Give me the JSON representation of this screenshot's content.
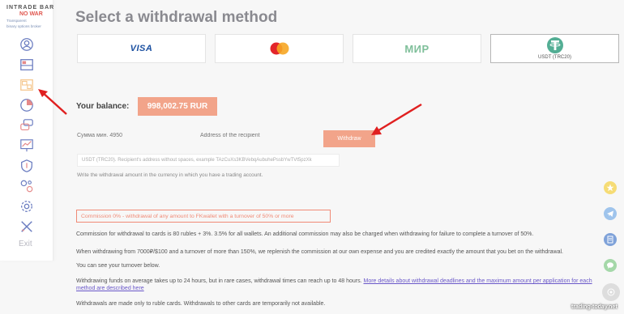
{
  "brand": {
    "name": "INTRADE BAR",
    "nowar": "NO WAR",
    "tagline_1": "Transparent",
    "tagline_2": "binary options broker"
  },
  "sidebar": {
    "items": [
      {
        "icon": "user-icon"
      },
      {
        "icon": "dashboard-icon"
      },
      {
        "icon": "finance-icon",
        "active": true
      },
      {
        "icon": "history-icon"
      },
      {
        "icon": "chat-icon"
      },
      {
        "icon": "analytics-icon"
      },
      {
        "icon": "security-icon"
      },
      {
        "icon": "settings-tools-icon"
      },
      {
        "icon": "gear-icon"
      },
      {
        "icon": "trade-swords-icon"
      }
    ],
    "exit_label": "Exit"
  },
  "page": {
    "title": "Select a withdrawal method"
  },
  "methods": [
    {
      "label": "VISA"
    },
    {
      "label": "MasterCard"
    },
    {
      "label": "МИР"
    },
    {
      "label": "USDT (TRC20)",
      "selected": true
    }
  ],
  "balance": {
    "label": "Your balance:",
    "value": "998,002.75 RUR"
  },
  "form": {
    "amount_placeholder": "Сумма мин. 4950",
    "address_placeholder": "Address of the recipient",
    "withdraw_label": "Withdraw",
    "hint_box": "USDT (TRC20). Recipient's address without spaces, example TAzCuXs3KBVebqAubuhePssbYwTVt5pzXk",
    "hint_text": "Write the withdrawal amount in the currency in which you have a trading account."
  },
  "info": {
    "commission_note": "Commission 0% - withdrawal of any amount to FKwallet with a turnover of 50% or more",
    "p1": "Commission for withdrawal to cards is 80 rubles + 3%. 3.5% for all wallets. An additional commission may also be charged when withdrawing for failure to complete a turnover of 50%.",
    "p2": "When withdrawing from 7000₽/$100 and a turnover of more than 150%, we replenish the commission at our own expense and you are credited exactly the amount that you bet on the withdrawal.",
    "p3": "You can see your turnover below.",
    "p4_text": "Withdrawing funds on average takes up to 24 hours, but in rare cases, withdrawal times can reach up to 48 hours.",
    "p4_link": "More details about withdrawal deadlines and the maximum amount per application for each method are described here",
    "p5": "Withdrawals are made only to ruble cards. Withdrawals to other cards are temporarily not available."
  },
  "floating_buttons": [
    {
      "icon": "star-icon",
      "color": "#f6dc75"
    },
    {
      "icon": "telegram-icon",
      "color": "#9fc4ec"
    },
    {
      "icon": "document-icon",
      "color": "#7fa2d9"
    },
    {
      "icon": "chat-bubble-icon",
      "color": "#a5d8a9"
    },
    {
      "icon": "support-icon",
      "color": "#dddddd"
    }
  ],
  "watermark": "trading-today.net",
  "colors": {
    "accent": "#f2a48a",
    "commission_border": "#f08a76",
    "link": "#6a58c9",
    "arrow": "#e02020"
  }
}
